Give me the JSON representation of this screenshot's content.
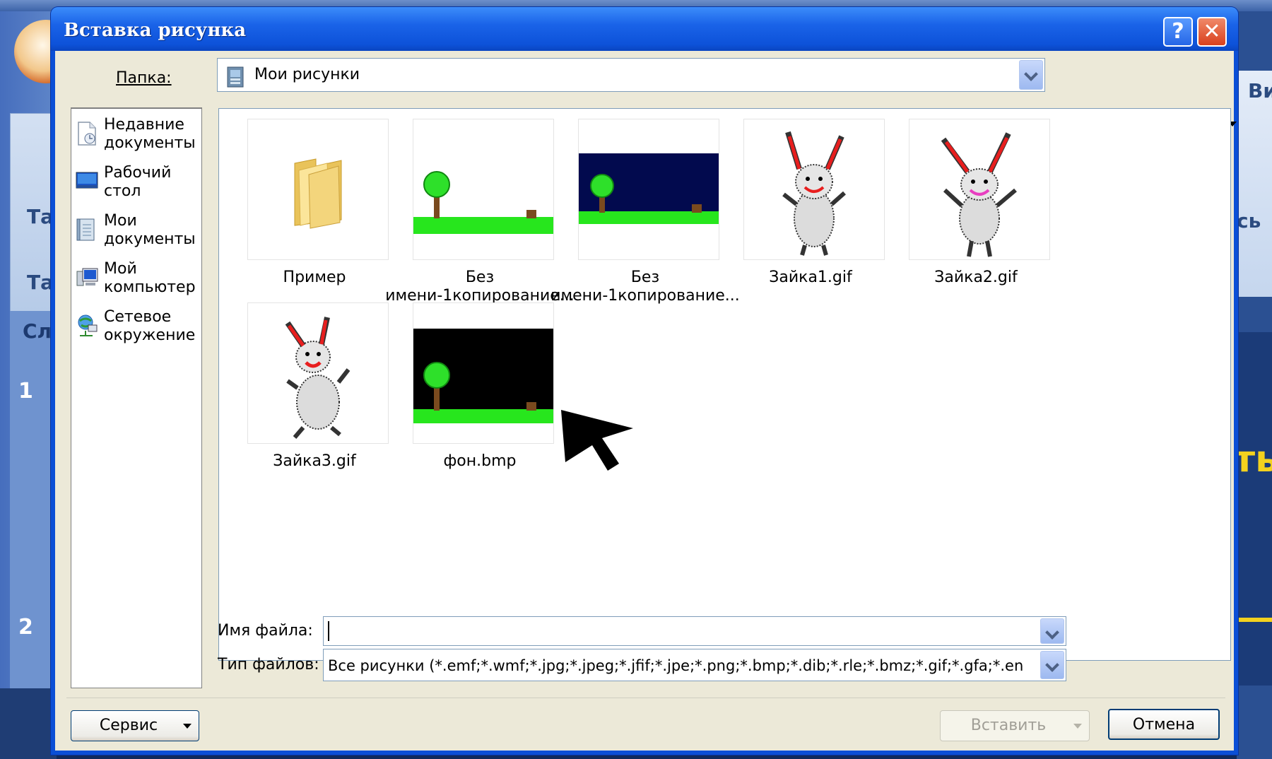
{
  "background": {
    "left_labels": [
      "Та",
      "Та",
      "Сл"
    ],
    "slide_numbers": [
      "1",
      "2"
    ],
    "right_labels": [
      "Ви",
      "сь",
      "ть"
    ]
  },
  "dialog": {
    "title": "Вставка рисунка",
    "help_label": "?",
    "close_label": "✕",
    "folder_label": "Папка:",
    "folder_value": "Мои рисунки",
    "places": [
      {
        "label": "Недавние\nдокументы",
        "icon": "recent-documents-icon"
      },
      {
        "label": "Рабочий\nстол",
        "icon": "desktop-icon"
      },
      {
        "label": "Мои\nдокументы",
        "icon": "my-documents-icon"
      },
      {
        "label": "Мой\nкомпьютер",
        "icon": "my-computer-icon"
      },
      {
        "label": "Сетевое\nокружение",
        "icon": "network-icon"
      }
    ],
    "files": [
      {
        "name": "Пример",
        "type": "folder"
      },
      {
        "name": "Без\nимени-1копирование...",
        "type": "image-white"
      },
      {
        "name": "Без\nимени-1копирование...",
        "type": "image-navy"
      },
      {
        "name": "Зайка1.gif",
        "type": "bunny"
      },
      {
        "name": "Зайка2.gif",
        "type": "bunny"
      },
      {
        "name": "Зайка3.gif",
        "type": "bunny"
      },
      {
        "name": "фон.bmp",
        "type": "image-black"
      }
    ],
    "filename_label": "Имя файла:",
    "filename_value": "",
    "filetype_label": "Тип файлов:",
    "filetype_value": "Все рисунки (*.emf;*.wmf;*.jpg;*.jpeg;*.jfif;*.jpe;*.png;*.bmp;*.dib;*.rle;*.bmz;*.gif;*.gfa;*.en",
    "tools_button": "Сервис",
    "insert_button": "Вставить",
    "cancel_button": "Отмена"
  }
}
